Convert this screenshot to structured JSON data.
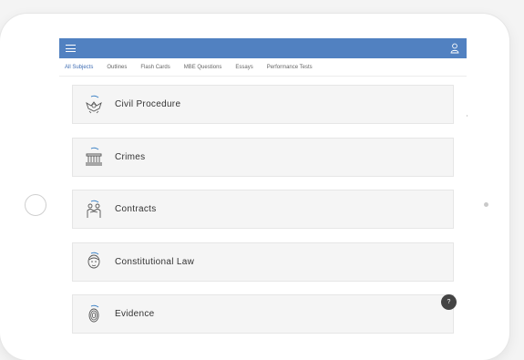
{
  "header": {
    "menu_icon": "hamburger-menu-icon",
    "user_icon": "user-icon",
    "bar_color": "#5181c1"
  },
  "tabs": [
    {
      "label": "All Subjects",
      "active": true
    },
    {
      "label": "Outlines",
      "active": false
    },
    {
      "label": "Flash Cards",
      "active": false
    },
    {
      "label": "MBE Questions",
      "active": false
    },
    {
      "label": "Essays",
      "active": false
    },
    {
      "label": "Performance Tests",
      "active": false
    }
  ],
  "subjects": [
    {
      "label": "Civil Procedure",
      "icon": "eagle-seal-icon"
    },
    {
      "label": "Crimes",
      "icon": "courthouse-icon"
    },
    {
      "label": "Contracts",
      "icon": "handshake-people-icon"
    },
    {
      "label": "Constitutional Law",
      "icon": "founder-portrait-icon"
    },
    {
      "label": "Evidence",
      "icon": "fingerprint-icon"
    }
  ],
  "help": {
    "label": "?"
  }
}
